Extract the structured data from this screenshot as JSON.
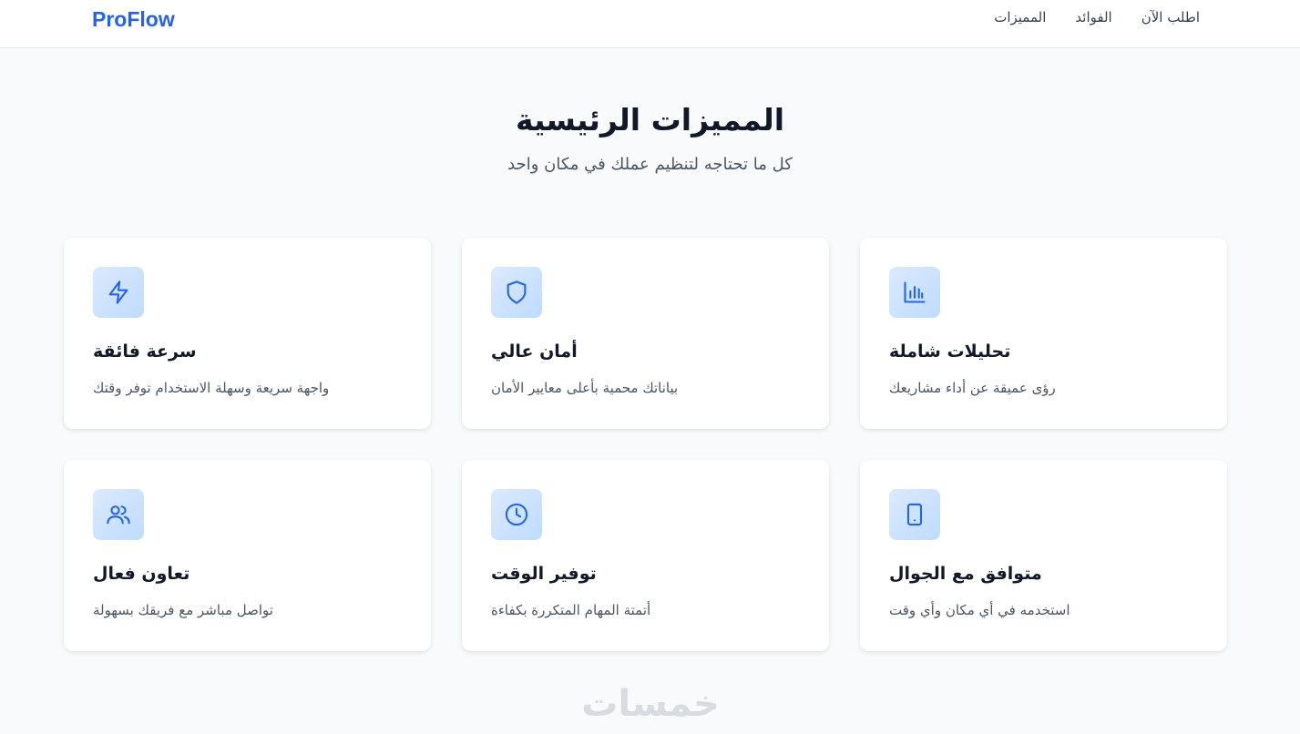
{
  "header": {
    "logo": "ProFlow",
    "nav": [
      {
        "label": "اطلب الآن"
      },
      {
        "label": "الفوائد"
      },
      {
        "label": "المميزات"
      }
    ]
  },
  "features": {
    "title": "المميزات الرئيسية",
    "subtitle": "كل ما تحتاجه لتنظيم عملك في مكان واحد",
    "cards": [
      {
        "icon": "bolt-icon",
        "title": "سرعة فائقة",
        "desc": "واجهة سريعة وسهلة الاستخدام توفر وقتك"
      },
      {
        "icon": "shield-icon",
        "title": "أمان عالي",
        "desc": "بياناتك محمية بأعلى معايير الأمان"
      },
      {
        "icon": "bar-chart-icon",
        "title": "تحليلات شاملة",
        "desc": "رؤى عميقة عن أداء مشاريعك"
      },
      {
        "icon": "users-icon",
        "title": "تعاون فعال",
        "desc": "تواصل مباشر مع فريقك بسهولة"
      },
      {
        "icon": "clock-icon",
        "title": "توفير الوقت",
        "desc": "أتمتة المهام المتكررة بكفاءة"
      },
      {
        "icon": "mobile-icon",
        "title": "متوافق مع الجوال",
        "desc": "استخدمه في أي مكان وأي وقت"
      }
    ]
  },
  "watermark": "خمسات",
  "colors": {
    "brand": "#2563eb",
    "background": "#f8fafc",
    "icon_bg": "#dbeafe"
  }
}
